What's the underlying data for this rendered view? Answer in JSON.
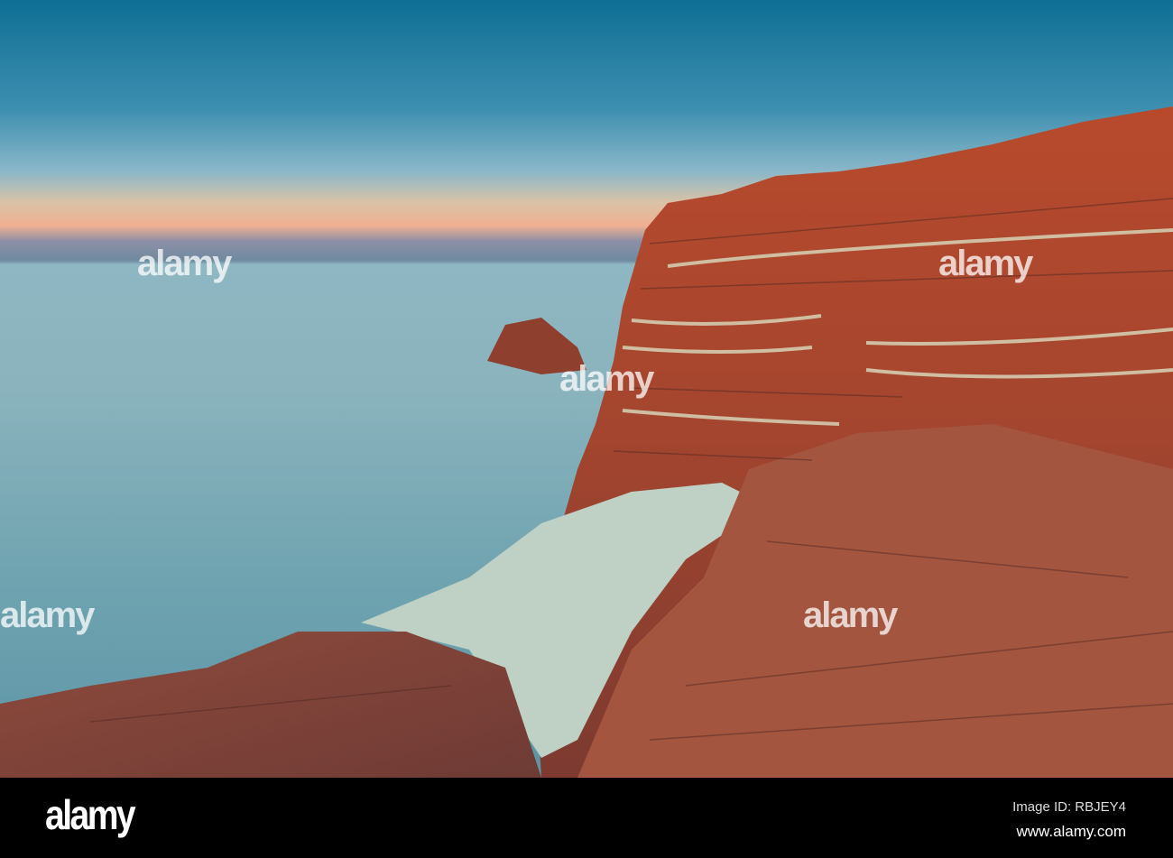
{
  "watermark": {
    "text": "alamy"
  },
  "footer": {
    "logo": "alamy",
    "image_id": "Image ID: RBJEY4",
    "site": "www.alamy.com"
  },
  "colors": {
    "sky_top": "#0f6f95",
    "horizon": "#f0b090",
    "sea": "#8ab3bd",
    "rock": "#a9482f",
    "rock_light": "#c4d6c8"
  }
}
